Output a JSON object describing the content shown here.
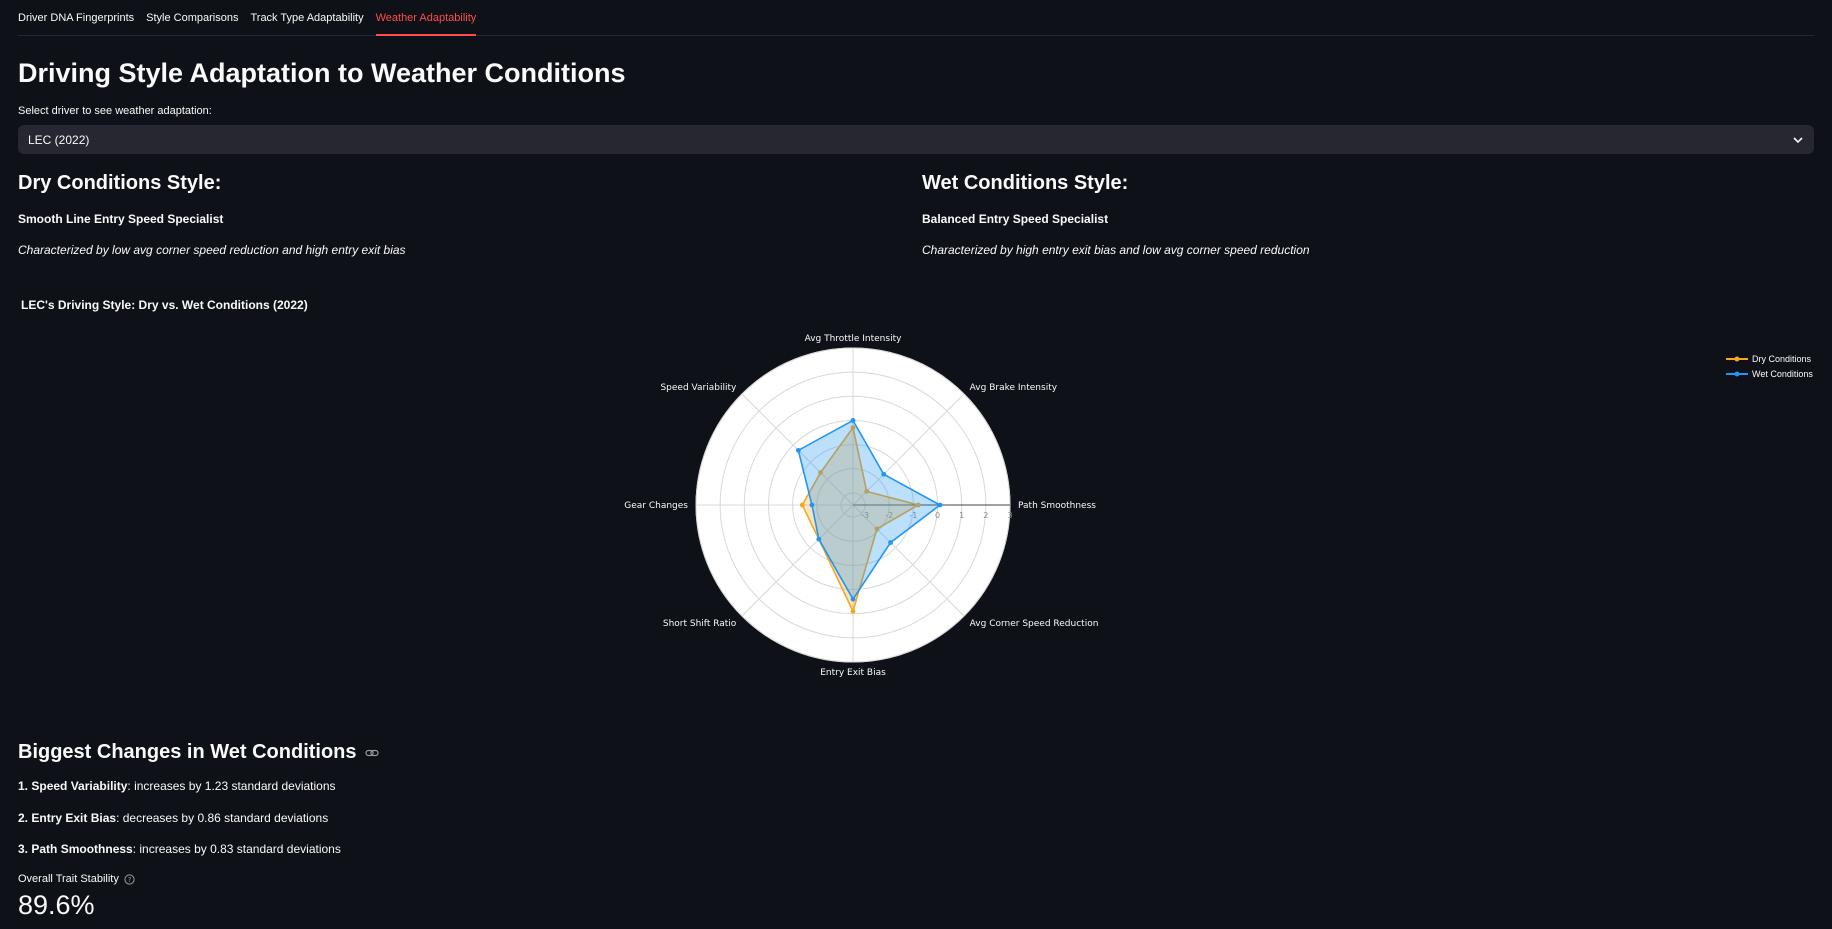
{
  "tabs": [
    {
      "label": "Driver DNA Fingerprints",
      "active": false
    },
    {
      "label": "Style Comparisons",
      "active": false
    },
    {
      "label": "Track Type Adaptability",
      "active": false
    },
    {
      "label": "Weather Adaptability",
      "active": true
    }
  ],
  "page_title": "Driving Style Adaptation to Weather Conditions",
  "driver_select": {
    "label": "Select driver to see weather adaptation:",
    "value": "LEC (2022)"
  },
  "dry": {
    "heading": "Dry Conditions Style:",
    "style_name": "Smooth Line Entry Speed Specialist",
    "description": "Characterized by low avg corner speed reduction and high entry exit bias"
  },
  "wet": {
    "heading": "Wet Conditions Style:",
    "style_name": "Balanced Entry Speed Specialist",
    "description": "Characterized by high entry exit bias and low avg corner speed reduction"
  },
  "chart_title": "LEC's Driving Style: Dry vs. Wet Conditions (2022)",
  "colors": {
    "dry": "#f5a623",
    "wet": "#2196f3",
    "accent": "#ff4b4b",
    "background": "#0e1117"
  },
  "chart_data": {
    "type": "radar",
    "axes": [
      "Avg Throttle Intensity",
      "Avg Brake Intensity",
      "Path Smoothness",
      "Avg Corner Speed Reduction",
      "Entry Exit Bias",
      "Short Shift Ratio",
      "Gear Changes",
      "Speed Variability"
    ],
    "radial_ticks": [
      "-3",
      "-2",
      "-1",
      "0",
      "1",
      "2",
      "3"
    ],
    "radial_range": [
      -3.5,
      3
    ],
    "series": [
      {
        "name": "Dry Conditions",
        "color": "#f5a623",
        "values": [
          -0.3,
          -2.7,
          -0.8,
          -2.1,
          0.9,
          -1.5,
          -1.4,
          -1.6
        ]
      },
      {
        "name": "Wet Conditions",
        "color": "#2196f3",
        "values": [
          0.0,
          -1.7,
          0.1,
          -1.3,
          0.4,
          -1.5,
          -1.8,
          -0.3
        ]
      }
    ],
    "legend_position": "top-right"
  },
  "legend": [
    {
      "label": "Dry Conditions",
      "color": "#f5a623"
    },
    {
      "label": "Wet Conditions",
      "color": "#2196f3"
    }
  ],
  "biggest_changes": {
    "title": "Biggest Changes in Wet Conditions",
    "items": [
      {
        "rank": "1.",
        "trait": "Speed Variability",
        "text": ": increases by 1.23 standard deviations"
      },
      {
        "rank": "2.",
        "trait": "Entry Exit Bias",
        "text": ": decreases by 0.86 standard deviations"
      },
      {
        "rank": "3.",
        "trait": "Path Smoothness",
        "text": ": increases by 0.83 standard deviations"
      }
    ]
  },
  "stability": {
    "label": "Overall Trait Stability",
    "value": "89.6%"
  }
}
